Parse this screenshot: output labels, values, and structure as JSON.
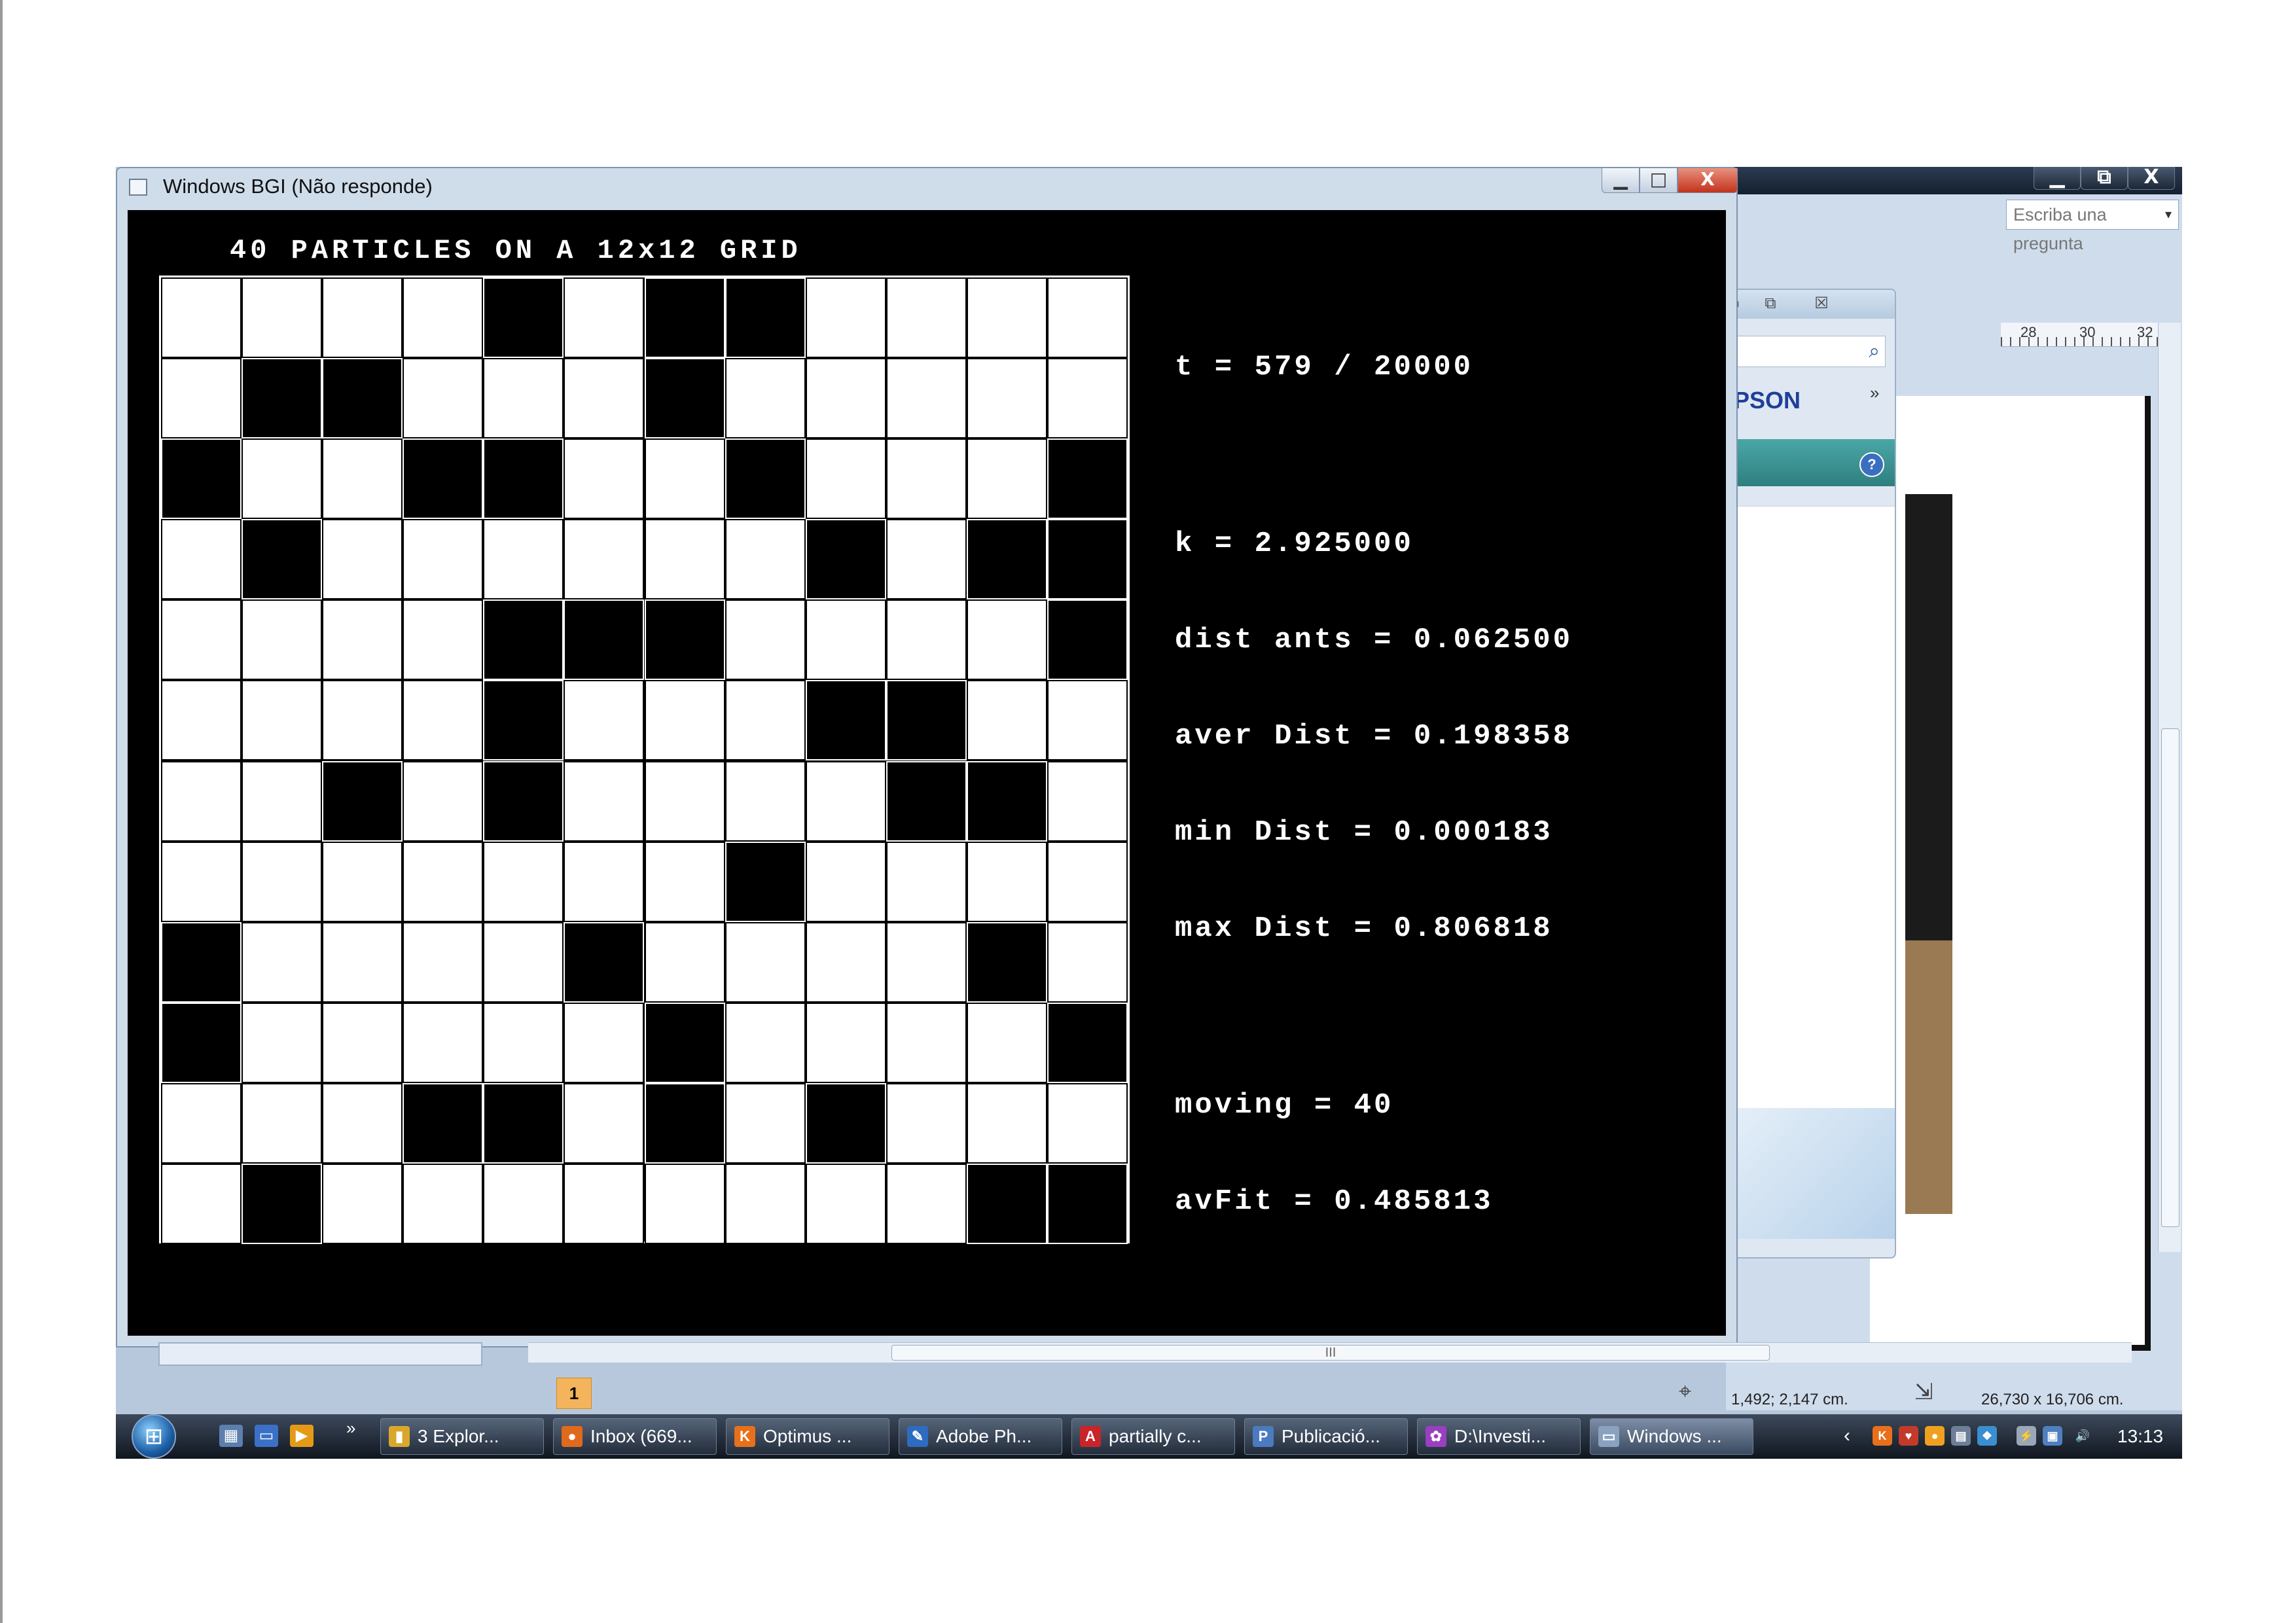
{
  "bgi_window": {
    "title": "Windows BGI (Não responde)",
    "grid_title": "40 PARTICLES ON A 12x12 GRID",
    "grid_cells": [
      [
        0,
        0,
        0,
        0,
        1,
        0,
        1,
        1,
        0,
        0,
        0,
        0
      ],
      [
        0,
        1,
        1,
        0,
        0,
        0,
        1,
        0,
        0,
        0,
        0,
        0
      ],
      [
        1,
        0,
        0,
        1,
        1,
        0,
        0,
        1,
        0,
        0,
        0,
        1
      ],
      [
        0,
        1,
        0,
        0,
        0,
        0,
        0,
        0,
        1,
        0,
        1,
        1
      ],
      [
        0,
        0,
        0,
        0,
        1,
        1,
        1,
        0,
        0,
        0,
        0,
        1
      ],
      [
        0,
        0,
        0,
        0,
        1,
        0,
        0,
        0,
        1,
        1,
        0,
        0
      ],
      [
        0,
        0,
        1,
        0,
        1,
        0,
        0,
        0,
        0,
        1,
        1,
        0
      ],
      [
        0,
        0,
        0,
        0,
        0,
        0,
        0,
        1,
        0,
        0,
        0,
        0
      ],
      [
        1,
        0,
        0,
        0,
        0,
        1,
        0,
        0,
        0,
        0,
        1,
        0
      ],
      [
        1,
        0,
        0,
        0,
        0,
        0,
        1,
        0,
        0,
        0,
        0,
        1
      ],
      [
        0,
        0,
        0,
        1,
        1,
        0,
        1,
        0,
        1,
        0,
        0,
        0
      ],
      [
        0,
        1,
        0,
        0,
        0,
        0,
        0,
        0,
        0,
        0,
        1,
        1
      ]
    ],
    "stats": {
      "t": "t = 579 / 20000",
      "k": "k = 2.925000",
      "dist_ants": "dist ants = 0.062500",
      "aver_dist": "aver Dist = 0.198358",
      "min_dist": "min Dist = 0.000183",
      "max_dist": "max Dist = 0.806818",
      "moving": "moving = 40",
      "avfit": "avFit = 0.485813"
    },
    "buttons": {
      "minimize": "▁",
      "maximize": "□",
      "close": "X"
    }
  },
  "word_window": {
    "question_placeholder": "Escriba una pregunta",
    "question_dropdown": "▾",
    "ruler": [
      "28",
      "30",
      "32"
    ],
    "buttons": {
      "minimize": "▁",
      "restore": "⧉",
      "close": "X"
    }
  },
  "epson_dialog": {
    "logo": "EPSON",
    "chevron": "»",
    "help": "?",
    "buttons": {
      "minimize": "▭",
      "restore": "⧉",
      "close": "☒"
    }
  },
  "status_bar": {
    "page_marker": "1",
    "scroll_mark": "III",
    "position": "1,492; 2,147 cm.",
    "size": "26,730 x 16,706 cm."
  },
  "taskbar": {
    "more": "»",
    "tasks": [
      {
        "label": "3 Explor...",
        "icon": "folder-icon",
        "color": "#d9a72b",
        "glyph": "▮"
      },
      {
        "label": "Inbox (669...",
        "icon": "thunderbird-icon",
        "color": "#e06a1c",
        "glyph": "●"
      },
      {
        "label": "Optimus ...",
        "icon": "k-app-icon",
        "color": "#e8701a",
        "glyph": "K"
      },
      {
        "label": "Adobe Ph...",
        "icon": "adobe-icon",
        "color": "#2d6cc0",
        "glyph": "✎"
      },
      {
        "label": "partially c...",
        "icon": "pdf-icon",
        "color": "#c8242a",
        "glyph": "A"
      },
      {
        "label": "Publicació...",
        "icon": "publisher-icon",
        "color": "#4a7bbf",
        "glyph": "P"
      },
      {
        "label": "D:\\Investi...",
        "icon": "folder-color-icon",
        "color": "#9a3fc0",
        "glyph": "✿"
      },
      {
        "label": "Windows ...",
        "icon": "window-icon",
        "color": "#8aa2bf",
        "glyph": "▭"
      }
    ],
    "clock": "13:13"
  }
}
